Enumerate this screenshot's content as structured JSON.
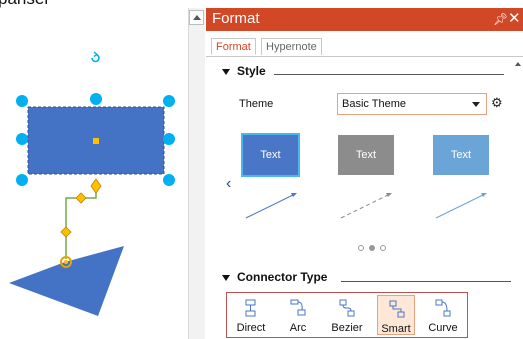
{
  "canvas": {
    "top_text": "pansel",
    "shape_rect_color": "#4472c4",
    "handle_color": "#00b0f0",
    "connector_color": "#70ad47",
    "connector_point_color": "#ffc000"
  },
  "panel": {
    "title": "Format",
    "header_color": "#d24726",
    "pin_icon": "pin-icon",
    "close_icon": "close-icon",
    "tabs": [
      {
        "label": "Format",
        "active": true
      },
      {
        "label": "Hypernote",
        "active": false
      }
    ],
    "style_section": {
      "heading": "Style",
      "theme_label": "Theme",
      "theme_value": "Basic Theme",
      "theme_cards": [
        {
          "label": "Text",
          "color": "#4a76c8",
          "selected": true
        },
        {
          "label": "Text",
          "color": "#8c8c8c",
          "selected": false
        },
        {
          "label": "Text",
          "color": "#6ba5d8",
          "selected": false
        }
      ],
      "carousel_page": 2,
      "carousel_pages": 3
    },
    "connector_section": {
      "heading": "Connector Type",
      "types": [
        {
          "label": "Direct",
          "selected": false
        },
        {
          "label": "Arc",
          "selected": false
        },
        {
          "label": "Bezier",
          "selected": false
        },
        {
          "label": "Smart",
          "selected": true
        },
        {
          "label": "Curve",
          "selected": false
        }
      ]
    }
  }
}
